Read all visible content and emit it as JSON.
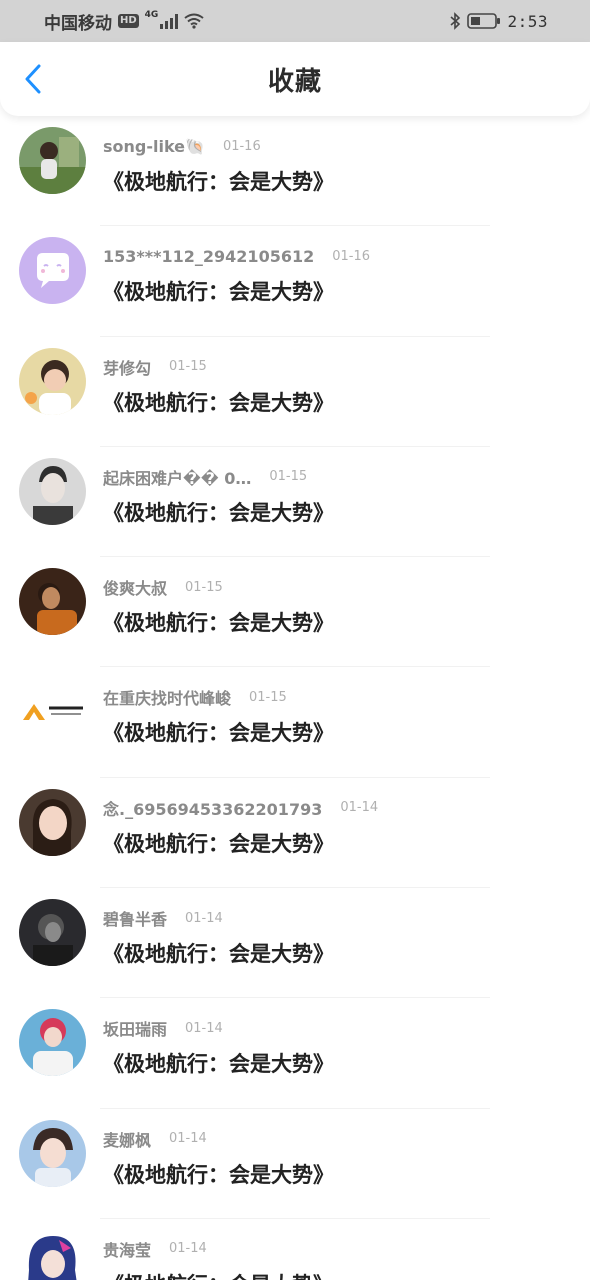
{
  "status_bar": {
    "carrier": "中国移动",
    "hd_badge": "HD",
    "network_type": "4G",
    "time": "2:53",
    "icons": [
      "signal-icon",
      "wifi-icon",
      "bluetooth-icon",
      "battery-icon"
    ]
  },
  "header": {
    "title": "收藏",
    "back_icon": "chevron-left-icon"
  },
  "colors": {
    "accent": "#1e90ff",
    "status_bar_bg": "#d3d3d3",
    "username": "#8a8a8a",
    "date": "#b0b0b0"
  },
  "favorites": [
    {
      "user": "song-like🐚",
      "date": "01-16",
      "title": "《极地航行：会是大势》"
    },
    {
      "user": "153***112_2942105612",
      "date": "01-16",
      "title": "《极地航行：会是大势》"
    },
    {
      "user": "芽修勾",
      "date": "01-15",
      "title": "《极地航行：会是大势》"
    },
    {
      "user": "起床困难户�� 0…",
      "date": "01-15",
      "title": "《极地航行：会是大势》"
    },
    {
      "user": "俊爽大叔",
      "date": "01-15",
      "title": "《极地航行：会是大势》"
    },
    {
      "user": "在重庆找时代峰峻",
      "date": "01-15",
      "title": "《极地航行：会是大势》"
    },
    {
      "user": "念._69569453362201793",
      "date": "01-14",
      "title": "《极地航行：会是大势》"
    },
    {
      "user": "碧鲁半香",
      "date": "01-14",
      "title": "《极地航行：会是大势》"
    },
    {
      "user": "坂田瑞雨",
      "date": "01-14",
      "title": "《极地航行：会是大势》"
    },
    {
      "user": "麦娜枫",
      "date": "01-14",
      "title": "《极地航行：会是大势》"
    },
    {
      "user": "贵海莹",
      "date": "01-14",
      "title": "《极地航行：会是大势》"
    }
  ]
}
